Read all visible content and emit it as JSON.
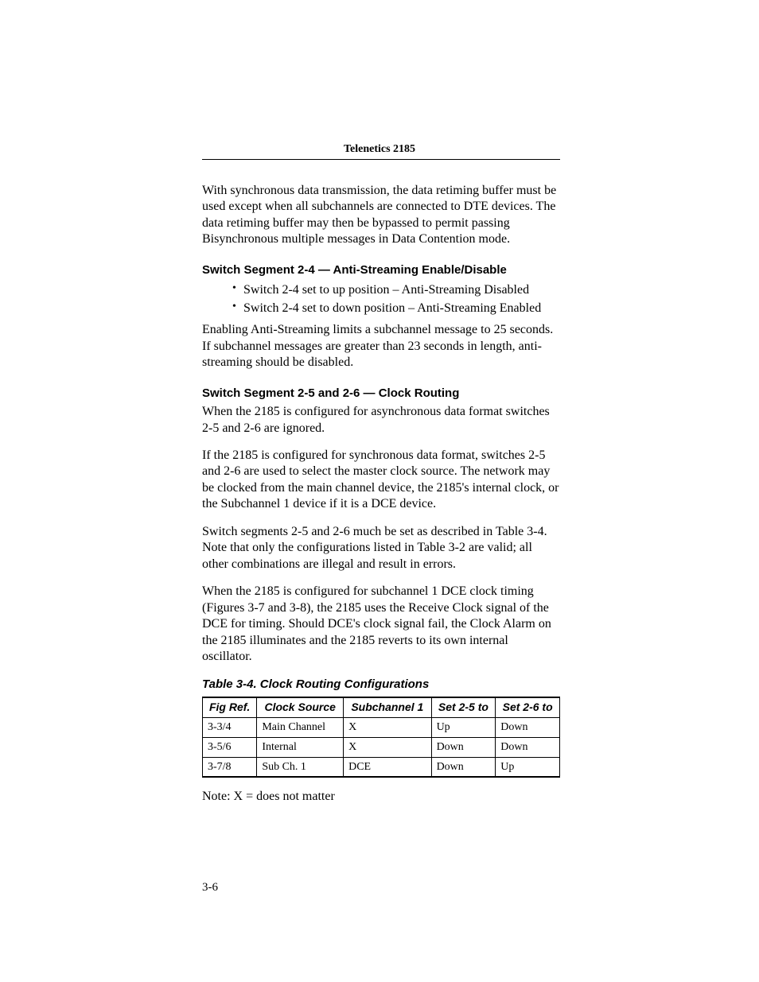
{
  "header": {
    "title": "Telenetics 2185"
  },
  "intro_para": "With synchronous data transmission, the data retiming buffer must be used except when all subchannels are connected to DTE devices. The data retiming buffer may then be bypassed to permit passing Bisynchronous multiple messages in Data Contention mode.",
  "section24": {
    "title": "Switch Segment 2-4 — Anti-Streaming Enable/Disable",
    "bullets": [
      "Switch 2-4 set to up position – Anti-Streaming Disabled",
      "Switch 2-4 set to down position – Anti-Streaming Enabled"
    ],
    "para": "Enabling Anti-Streaming limits a subchannel message to 25 seconds. If subchannel messages are greater than 23 seconds in length, anti-streaming should be disabled."
  },
  "section2526": {
    "title": "Switch Segment 2-5 and 2-6 — Clock Routing",
    "p1": "When the 2185 is configured for asynchronous data format switches 2-5 and 2-6 are ignored.",
    "p2": "If the 2185 is configured for synchronous data format, switches 2-5 and 2-6 are used to select the master clock source. The network may be clocked from the main channel device, the 2185's internal clock, or the Subchannel 1 device if it is a DCE device.",
    "p3": "Switch segments 2-5 and 2-6 much be set as described in Table 3-4. Note that only the configurations listed in Table 3-2 are valid; all other combinations are illegal and result in errors.",
    "p4": "When the 2185 is configured for subchannel 1 DCE clock timing (Figures 3-7 and 3-8), the 2185 uses the Receive Clock signal of the DCE for timing. Should DCE's clock signal fail, the Clock Alarm on the 2185 illuminates and the 2185 reverts to its own internal oscillator."
  },
  "table": {
    "caption": "Table 3-4. Clock Routing Configurations",
    "headers": [
      "Fig Ref.",
      "Clock Source",
      "Subchannel 1",
      "Set 2-5 to",
      "Set 2-6 to"
    ],
    "rows": [
      [
        "3-3/4",
        "Main Channel",
        "X",
        "Up",
        "Down"
      ],
      [
        "3-5/6",
        "Internal",
        "X",
        "Down",
        "Down"
      ],
      [
        "3-7/8",
        "Sub Ch. 1",
        "DCE",
        "Down",
        "Up"
      ]
    ],
    "note": "Note:  X = does not matter"
  },
  "page_number": "3-6"
}
